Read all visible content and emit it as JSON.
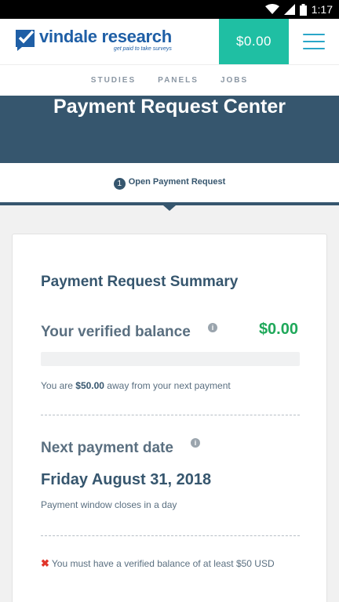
{
  "status_bar": {
    "time": "1:17"
  },
  "header": {
    "logo_name": "vindale research",
    "logo_tagline": "get paid to take surveys",
    "balance_button": "$0.00",
    "menu_icon": "hamburger-icon"
  },
  "nav": {
    "items": [
      {
        "label": "STUDIES"
      },
      {
        "label": "PANELS"
      },
      {
        "label": "JOBS"
      }
    ]
  },
  "banner": {
    "title": "Payment Request Center"
  },
  "step": {
    "number": "1",
    "label": "Open Payment Request"
  },
  "summary": {
    "title": "Payment Request Summary",
    "balance_label": "Your verified balance",
    "balance_value": "$0.00",
    "progress": 0,
    "away_prefix": "You are ",
    "away_amount": "$50.00",
    "away_suffix": " away from your next payment",
    "next_label": "Next payment date",
    "next_date": "Friday August 31, 2018",
    "window_text": "Payment window closes in a day",
    "error_text": "You must have a verified balance of at least $50 USD",
    "info_glyph": "i",
    "error_glyph": "✖"
  },
  "colors": {
    "brand": "#1f5fa6",
    "accent": "#1fbfa3",
    "banner": "#36566e",
    "balance_green": "#1fa85a",
    "error_red": "#e0352b"
  }
}
